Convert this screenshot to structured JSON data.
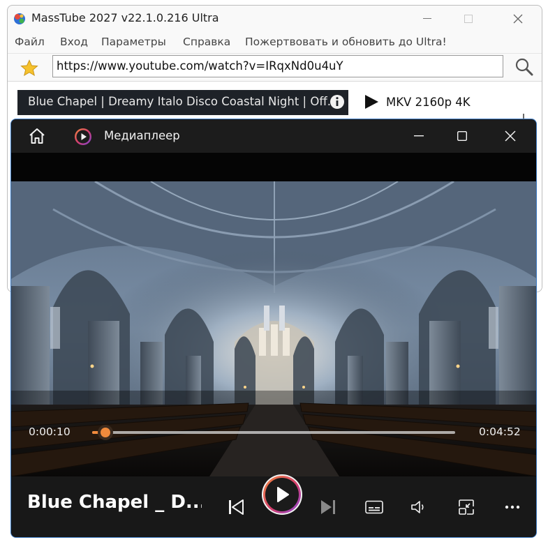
{
  "masstube": {
    "title": "MassTube 2027 v22.1.0.216 Ultra",
    "menu": [
      "Файл",
      "Вход",
      "Параметры",
      "Справка",
      "Пожертвовать и обновить до Ultra!"
    ],
    "url_value": "https://www.youtube.com/watch?v=IRqxNd0u4uY",
    "video_title": "Blue Chapel | Dreamy Italo Disco Coastal Night | Off...",
    "format_label": "MKV 2160p 4K"
  },
  "player": {
    "window_title": "Медиаплеер",
    "current_time": "0:00:10",
    "total_time": "0:04:52",
    "progress": 0.036,
    "now_playing_title": "Blue Chapel _ D...",
    "colors": {
      "accent": "#f08a3c",
      "window_border": "#3c7bc4"
    }
  }
}
